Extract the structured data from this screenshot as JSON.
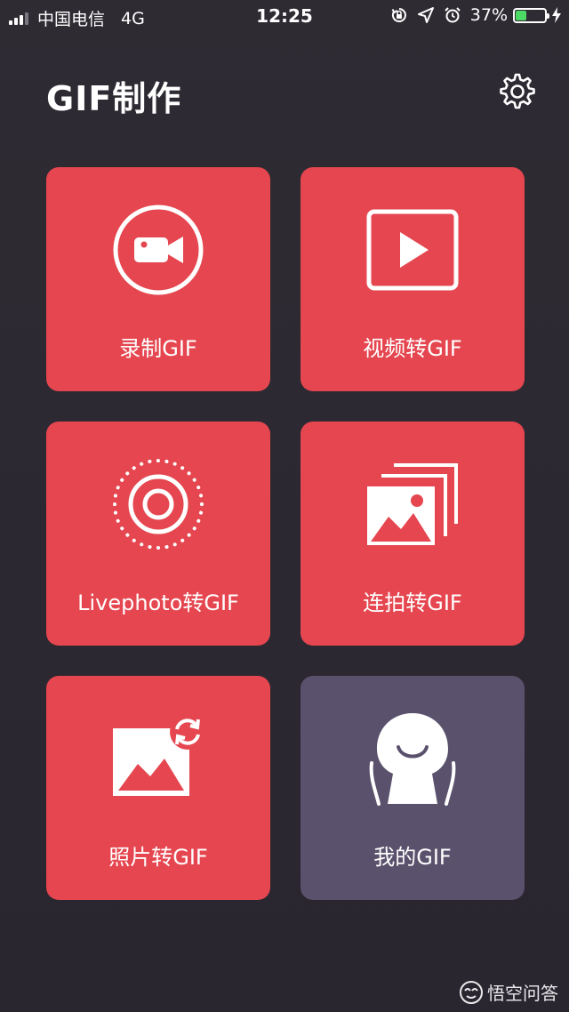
{
  "status_bar": {
    "carrier": "中国电信",
    "network": "4G",
    "time": "12:25",
    "battery_percent": "37%",
    "battery_level": 0.37,
    "battery_color": "#4cd964"
  },
  "header": {
    "title": "GIF制作",
    "settings_icon": "gear-icon"
  },
  "tiles": [
    {
      "label": "录制GIF",
      "icon": "video-camera-icon",
      "color": "#e5464f"
    },
    {
      "label": "视频转GIF",
      "icon": "play-video-icon",
      "color": "#e5464f"
    },
    {
      "label": "Livephoto转GIF",
      "icon": "live-photo-icon",
      "color": "#e5464f"
    },
    {
      "label": "连拍转GIF",
      "icon": "burst-photos-icon",
      "color": "#e5464f"
    },
    {
      "label": "照片转GIF",
      "icon": "photo-convert-icon",
      "color": "#e5464f"
    },
    {
      "label": "我的GIF",
      "icon": "person-icon",
      "color": "#5a516c"
    }
  ],
  "watermark": {
    "text": "悟空问答"
  }
}
